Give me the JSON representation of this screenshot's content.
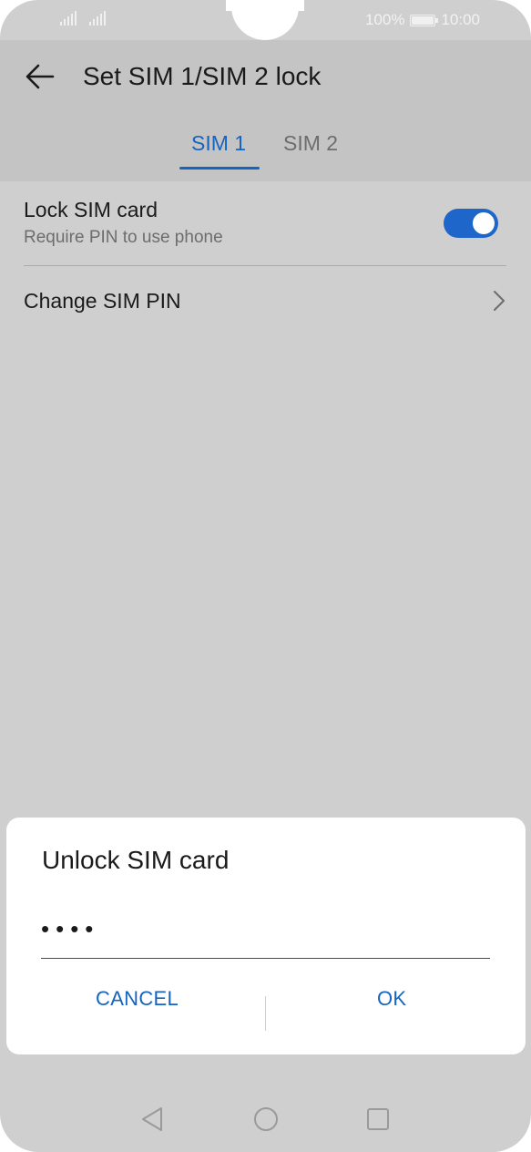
{
  "status_bar": {
    "battery": "100%",
    "time": "10:00"
  },
  "header": {
    "title": "Set SIM 1/SIM 2 lock",
    "back_icon": "arrow-left-icon",
    "tabs": [
      {
        "label": "SIM 1",
        "selected": true
      },
      {
        "label": "SIM 2",
        "selected": false
      }
    ]
  },
  "settings": {
    "lock_sim": {
      "title": "Lock SIM card",
      "subtitle": "Require PIN to use phone",
      "enabled": true
    },
    "change_pin": {
      "title": "Change SIM PIN",
      "icon": "chevron-right-icon"
    }
  },
  "dialog": {
    "title": "Unlock SIM card",
    "pin_value": "••••",
    "cancel_label": "CANCEL",
    "ok_label": "OK"
  },
  "nav": {
    "back_icon": "triangle-back-icon",
    "home_icon": "circle-home-icon",
    "recents_icon": "square-recents-icon"
  },
  "colors": {
    "accent": "#1565c0",
    "toggle_on": "#1e66c9",
    "overlay": "#cfcfcf"
  }
}
